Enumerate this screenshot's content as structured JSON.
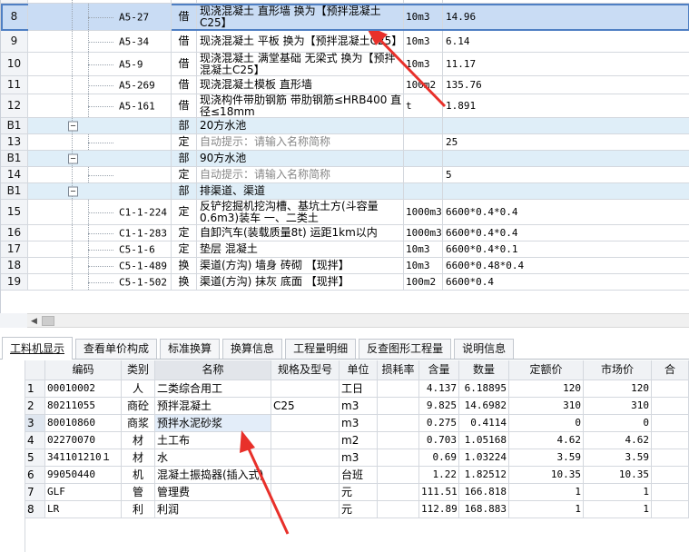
{
  "upper_rows": [
    {
      "num": "",
      "code": "",
      "type": "",
      "name": "",
      "unit": "",
      "qty": ""
    },
    {
      "num": "8",
      "code": "A5-27",
      "type": "借",
      "name": "现浇混凝土 直形墙  换为【预拌混凝土C25】",
      "unit": "10m3",
      "qty": "14.96",
      "selected": true
    },
    {
      "num": "9",
      "code": "A5-34",
      "type": "借",
      "name": "现浇混凝土 平板  换为【预拌混凝土C25】",
      "unit": "10m3",
      "qty": "6.14"
    },
    {
      "num": "10",
      "code": "A5-9",
      "type": "借",
      "name": "现浇混凝土 满堂基础 无梁式  换为【预拌混凝土C25】",
      "unit": "10m3",
      "qty": "11.17"
    },
    {
      "num": "11",
      "code": "A5-269",
      "type": "借",
      "name": "现浇混凝土模板 直形墙",
      "unit": "100m2",
      "qty": "135.76"
    },
    {
      "num": "12",
      "code": "A5-161",
      "type": "借",
      "name": "现浇构件带肋钢筋 带肋钢筋≤HRB400 直径≤18mm",
      "unit": "t",
      "qty": "1.891"
    },
    {
      "num": "B1",
      "code": "",
      "type": "部",
      "name": "20方水池",
      "unit": "",
      "qty": "",
      "group": true
    },
    {
      "num": "13",
      "code": "",
      "type": "定",
      "name": "自动提示：请输入名称简称",
      "unit": "",
      "qty": "25",
      "hint": true
    },
    {
      "num": "B1",
      "code": "",
      "type": "部",
      "name": "90方水池",
      "unit": "",
      "qty": "",
      "group": true
    },
    {
      "num": "14",
      "code": "",
      "type": "定",
      "name": "自动提示：请输入名称简称",
      "unit": "",
      "qty": "5",
      "hint": true
    },
    {
      "num": "B1",
      "code": "",
      "type": "部",
      "name": "排渠道、渠道",
      "unit": "",
      "qty": "",
      "group": true
    },
    {
      "num": "15",
      "code": "C1-1-224",
      "type": "定",
      "name": "反铲挖掘机挖沟槽、基坑土方(斗容量0.6m3)装车 一、二类土",
      "unit": "1000m3",
      "qty": "6600*0.4*0.4"
    },
    {
      "num": "16",
      "code": "C1-1-283",
      "type": "定",
      "name": "自卸汽车(装载质量8t) 运距1km以内",
      "unit": "1000m3",
      "qty": "6600*0.4*0.4"
    },
    {
      "num": "17",
      "code": "C5-1-6",
      "type": "定",
      "name": "垫层 混凝土",
      "unit": "10m3",
      "qty": "6600*0.4*0.1"
    },
    {
      "num": "18",
      "code": "C5-1-489",
      "type": "换",
      "name": "渠道(方沟) 墙身 砖砌 【现拌】",
      "unit": "10m3",
      "qty": "6600*0.48*0.4"
    },
    {
      "num": "19",
      "code": "C5-1-502",
      "type": "换",
      "name": "渠道(方沟) 抹灰 底面  【现拌】",
      "unit": "100m2",
      "qty": "6600*0.4"
    }
  ],
  "tabs": [
    "工料机显示",
    "查看单价构成",
    "标准换算",
    "换算信息",
    "工程量明细",
    "反查图形工程量",
    "说明信息"
  ],
  "lower_headers": [
    "编码",
    "类别",
    "名称",
    "规格及型号",
    "单位",
    "损耗率",
    "含量",
    "数量",
    "定额价",
    "市场价",
    "合"
  ],
  "lower_rows": [
    {
      "no": "1",
      "code": "00010002",
      "cat": "人",
      "name": "二类综合用工",
      "spec": "",
      "unit": "工日",
      "loss": "",
      "qty": "4.137",
      "count": "6.18895",
      "quota": "120",
      "market": "120"
    },
    {
      "no": "2",
      "code": "80211055",
      "cat": "商砼",
      "name": "预拌混凝土",
      "spec": "C25",
      "unit": "m3",
      "loss": "",
      "qty": "9.825",
      "count": "14.6982",
      "quota": "310",
      "market": "310"
    },
    {
      "no": "3",
      "code": "80010860",
      "cat": "商浆",
      "name": "预拌水泥砂浆",
      "spec": "",
      "unit": "m3",
      "loss": "",
      "qty": "0.275",
      "count": "0.4114",
      "quota": "0",
      "market": "0",
      "selected": true
    },
    {
      "no": "4",
      "code": "02270070",
      "cat": "材",
      "name": "土工布",
      "spec": "",
      "unit": "m2",
      "loss": "",
      "qty": "0.703",
      "count": "1.05168",
      "quota": "4.62",
      "market": "4.62"
    },
    {
      "no": "5",
      "code": "341101210１",
      "cat": "材",
      "name": "水",
      "spec": "",
      "unit": "m3",
      "loss": "",
      "qty": "0.69",
      "count": "1.03224",
      "quota": "3.59",
      "market": "3.59"
    },
    {
      "no": "6",
      "code": "99050440",
      "cat": "机",
      "name": "混凝土振捣器(插入式)",
      "spec": "",
      "unit": "台班",
      "loss": "",
      "qty": "1.22",
      "count": "1.82512",
      "quota": "10.35",
      "market": "10.35"
    },
    {
      "no": "7",
      "code": "GLF",
      "cat": "管",
      "name": "管理费",
      "spec": "",
      "unit": "元",
      "loss": "",
      "qty": "111.51",
      "count": "166.818",
      "quota": "1",
      "market": "1"
    },
    {
      "no": "8",
      "code": "LR",
      "cat": "利",
      "name": "利润",
      "spec": "",
      "unit": "元",
      "loss": "",
      "qty": "112.89",
      "count": "168.883",
      "quota": "1",
      "market": "1"
    }
  ],
  "colors": {
    "annotation_arrow": "#e8302a",
    "selected_row": "#c9dcf4",
    "group_row": "#dfeef8"
  }
}
